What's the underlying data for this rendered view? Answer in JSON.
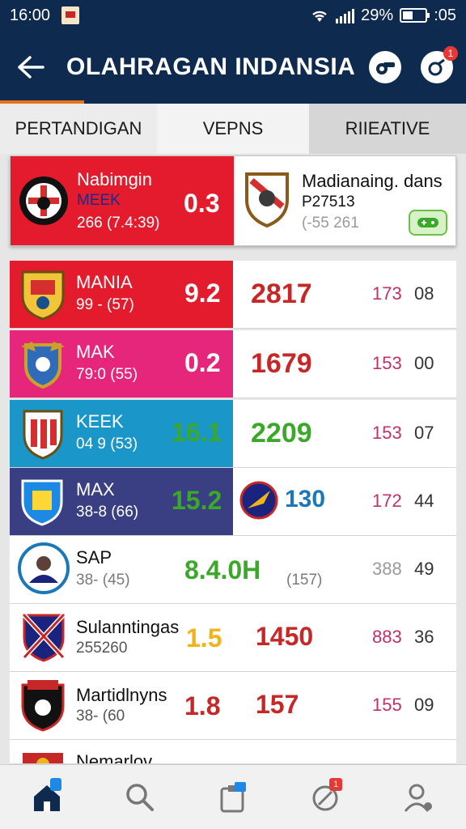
{
  "status": {
    "time": "16:00",
    "battery": "29%",
    "clock_right": ":05"
  },
  "header": {
    "title": "OLAHRAGAN INDANSIA",
    "notif_count": "1"
  },
  "tabs": [
    {
      "label": "PERTANDIGAN"
    },
    {
      "label": "VEPNS"
    },
    {
      "label": "RIIEATIVE"
    }
  ],
  "featured": {
    "home": {
      "name": "Nabimgin",
      "code": "MEEK",
      "sub": "266 (7.4:39)",
      "score": "0.3"
    },
    "away": {
      "name": "Madianaing. dans",
      "code": "P27513",
      "sub": "(-55 261"
    }
  },
  "rows": [
    {
      "name": "MANIA",
      "sub": "99 - (57)",
      "score": "9.2",
      "stat": "2817",
      "c1": "173",
      "c2": "08"
    },
    {
      "name": "MAK",
      "sub": "79:0 (55)",
      "score": "0.2",
      "stat": "1679",
      "c1": "153",
      "c2": "00"
    },
    {
      "name": "KEEK",
      "sub": "04 9 (53)",
      "score": "16.1",
      "stat": "2209",
      "c1": "153",
      "c2": "07"
    },
    {
      "name": "MAX",
      "sub": "38-8 (66)",
      "score": "15.2",
      "stat": "130",
      "c1": "172",
      "c2": "44"
    },
    {
      "name": "SAP",
      "sub": "38- (45)",
      "score": "8.4.0H",
      "extra": "(157)",
      "c1": "388",
      "c2": "49"
    },
    {
      "name": "Sulanntingas",
      "sub": "255260",
      "score": "1.5",
      "stat": "1450",
      "c1": "883",
      "c2": "36"
    },
    {
      "name": "Martidlnyns",
      "sub": "38- (60",
      "score": "1.8",
      "stat": "157",
      "c1": "155",
      "c2": "09"
    },
    {
      "name": "Nemarlov"
    }
  ],
  "colors": {
    "navy": "#0e2a4e",
    "red": "#e31b2d",
    "pink": "#e5267a",
    "blue": "#1b96c8",
    "indigo": "#3a3f83",
    "green": "#3aa829",
    "stat_red": "#c62828",
    "gold": "#f0b41a"
  },
  "bottom_nav": [
    {
      "icon": "home-icon",
      "label": "Home"
    },
    {
      "icon": "search-icon",
      "label": "Search"
    },
    {
      "icon": "clipboard-icon",
      "label": "Clipboard"
    },
    {
      "icon": "whistle-icon",
      "label": "Whistle",
      "badge": "1"
    },
    {
      "icon": "profile-icon",
      "label": "Profile"
    }
  ]
}
